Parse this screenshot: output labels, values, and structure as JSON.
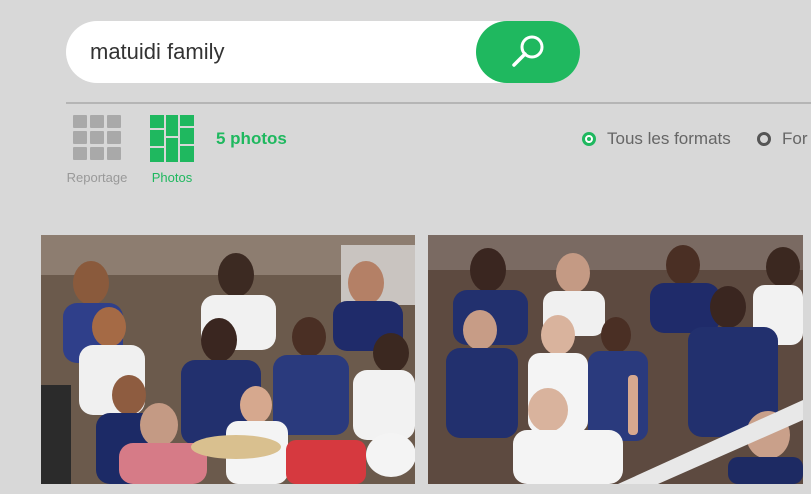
{
  "search": {
    "value": "matuidi family"
  },
  "view_toggle": {
    "reportage_label": "Reportage",
    "photos_label": "Photos"
  },
  "results": {
    "count_label": "5 photos"
  },
  "format_filter": {
    "options": [
      {
        "label": "Tous les formats",
        "selected": true
      },
      {
        "label": "For",
        "selected": false
      }
    ]
  },
  "colors": {
    "accent": "#1fb85f",
    "background": "#d8d8d8",
    "muted": "#999999"
  },
  "photos": [
    {
      "description_icon": "photo-thumbnail"
    },
    {
      "description_icon": "photo-thumbnail"
    }
  ]
}
